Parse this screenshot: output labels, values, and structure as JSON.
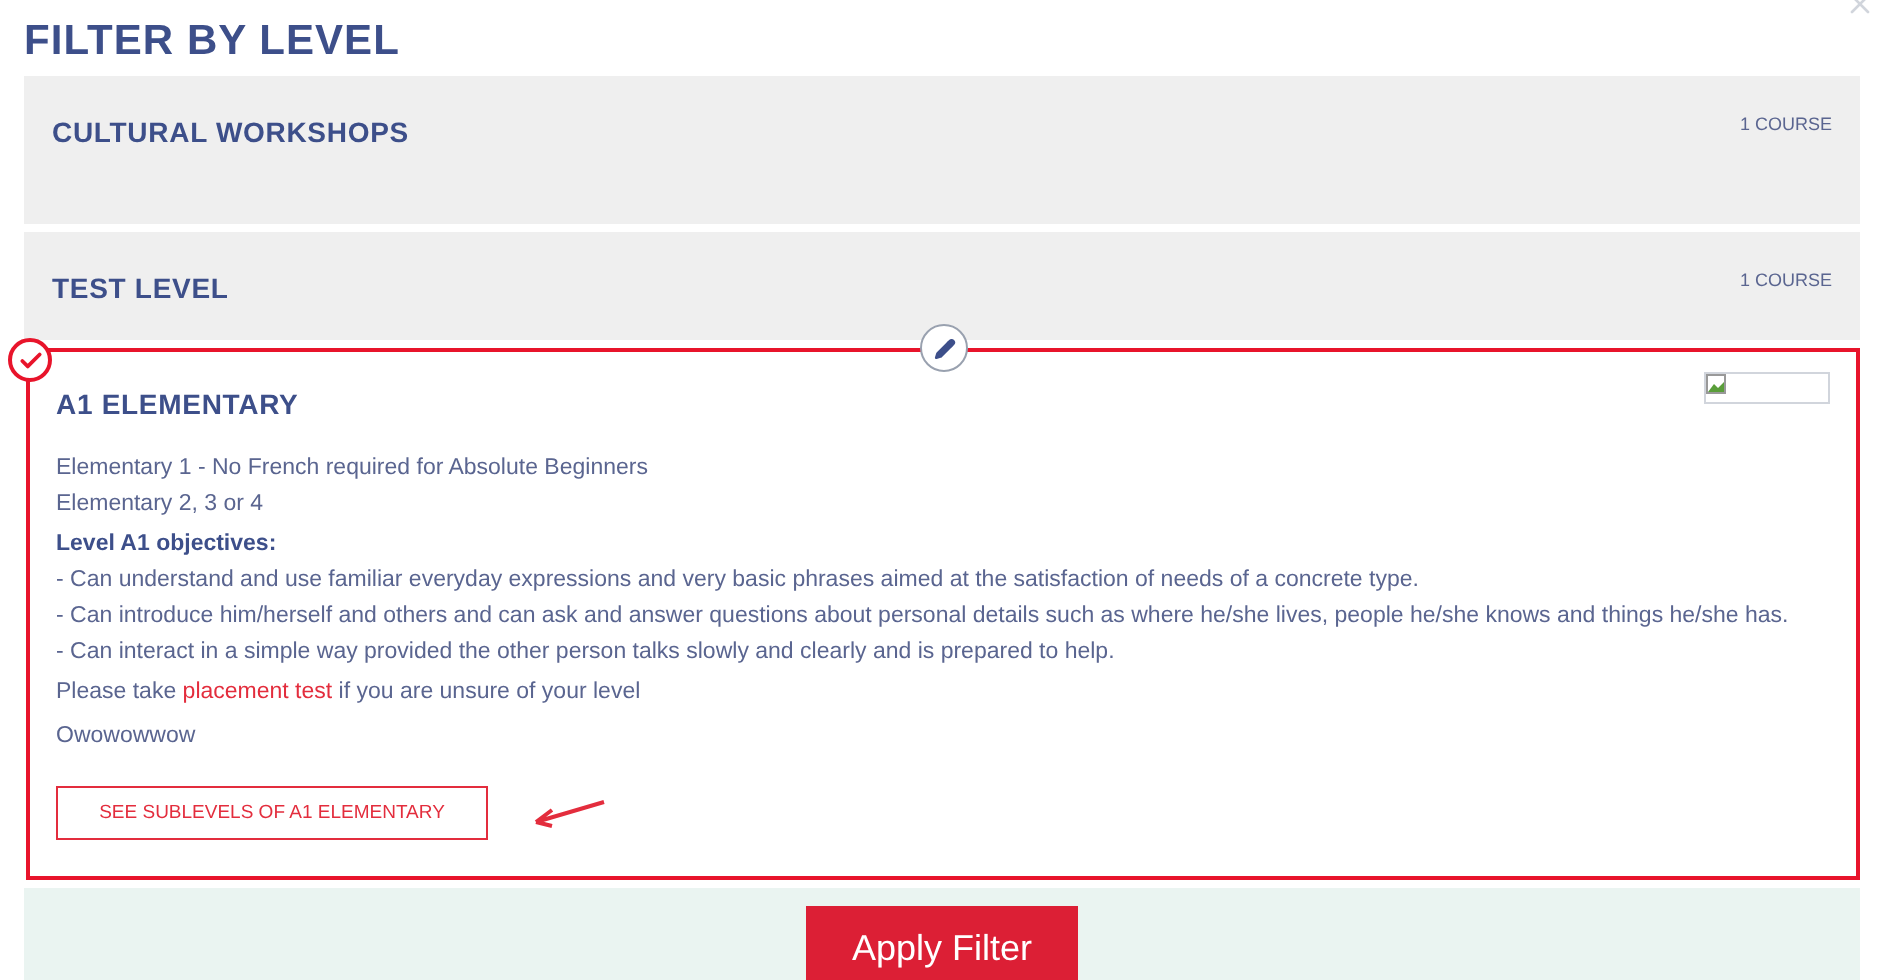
{
  "title": "FILTER BY LEVEL",
  "levels": [
    {
      "name": "CULTURAL WORKSHOPS",
      "count": "1 COURSE",
      "selected": false
    },
    {
      "name": "TEST LEVEL",
      "count": "1 COURSE",
      "selected": false
    },
    {
      "name": "A1 ELEMENTARY",
      "selected": true,
      "details": {
        "lines": [
          "Elementary 1 - No French required for Absolute Beginners",
          "Elementary 2, 3 or 4"
        ],
        "objectives_heading": "Level A1 objectives:",
        "objectives": [
          "- Can understand and use familiar everyday expressions and very basic phrases aimed at the satisfaction of needs of a concrete type.",
          "- Can introduce him/herself and others and can ask and answer questions about personal details such as where he/she lives, people he/she knows and things he/she has.",
          "- Can interact in a simple way provided the other person talks slowly and clearly and is prepared to help."
        ],
        "placement": {
          "before": "Please take ",
          "link": "placement test",
          "after": " if you are unsure of your level"
        },
        "note": "Owowowwow",
        "sublevels_button": "SEE SUBLEVELS OF A1 ELEMENTARY"
      }
    }
  ],
  "apply_button": "Apply Filter"
}
